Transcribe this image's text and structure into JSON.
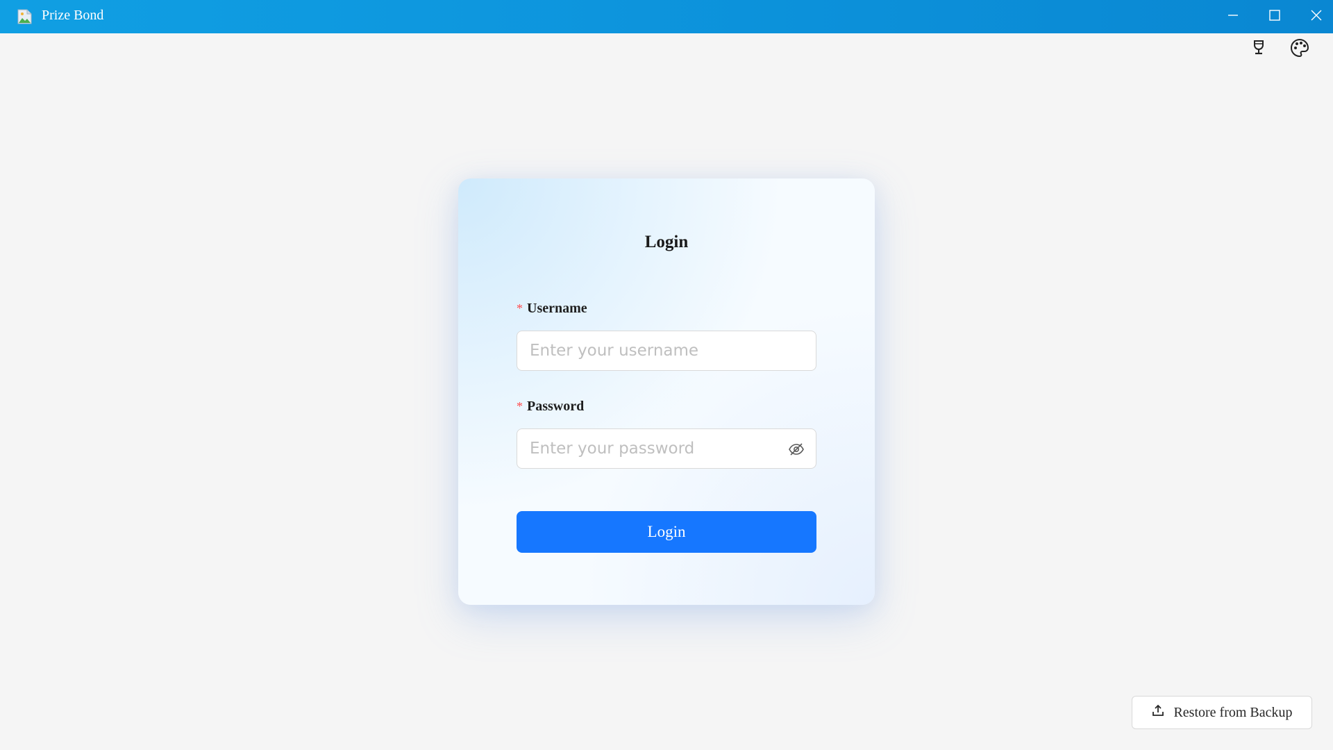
{
  "window": {
    "title": "Prize Bond",
    "app_icon": "broken-image-icon",
    "controls": [
      "minimize-icon",
      "maximize-icon",
      "close-icon"
    ],
    "titlebar_color": "#0d95dd"
  },
  "toolbar": {
    "icons": [
      "trophy-icon",
      "palette-icon"
    ]
  },
  "login_form": {
    "title": "Login",
    "username": {
      "label": "Username",
      "required_mark": "*",
      "placeholder": "Enter your username",
      "value": ""
    },
    "password": {
      "label": "Password",
      "required_mark": "*",
      "placeholder": "Enter your password",
      "value": "",
      "toggle_icon": "eye-invisible-icon"
    },
    "submit_label": "Login",
    "accent_color": "#1677ff",
    "required_color": "#ff4d4f"
  },
  "footer": {
    "restore_label": "Restore from Backup",
    "restore_icon": "upload-icon"
  }
}
